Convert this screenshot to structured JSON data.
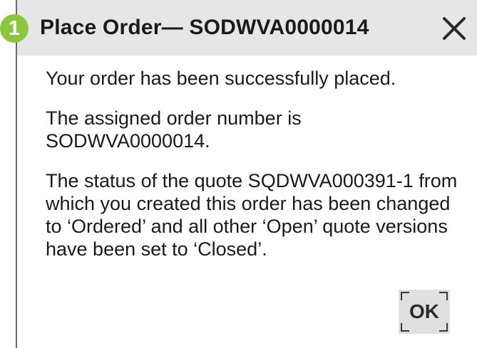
{
  "step_badge": "1",
  "dialog": {
    "title": "Place Order— SODWVA0000014",
    "close_icon": "close-x-icon",
    "paragraphs": [
      "Your order has been successfully placed.",
      "The assigned order number is SODWVA0000014.",
      "The status of the quote SQDWVA000391-1 from which you created this order has been changed to ‘Ordered’ and all other ‘Open’ quote versions have been set to ‘Closed’."
    ],
    "ok_label": "OK"
  },
  "colors": {
    "titlebar_bg": "#e6e6e6",
    "badge_green": "#8cc63f",
    "button_bg": "#e0e0e0",
    "text": "#1a1a1a"
  }
}
